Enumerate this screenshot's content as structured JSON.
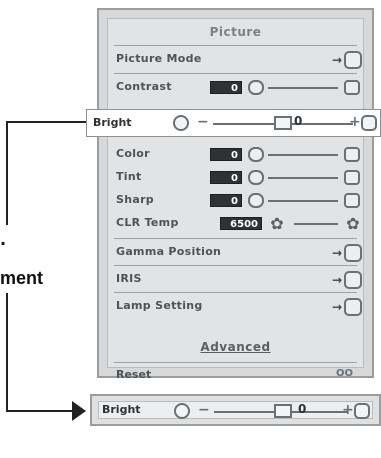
{
  "menu": {
    "title": "Picture",
    "rows": {
      "picture_mode": {
        "label": "Picture Mode",
        "action": "→"
      },
      "contrast": {
        "label": "Contrast",
        "value": "0"
      },
      "color": {
        "label": "Color",
        "value": "0"
      },
      "tint": {
        "label": "Tint",
        "value": "0"
      },
      "sharp": {
        "label": "Sharp",
        "value": "0"
      },
      "clr_temp": {
        "label": "CLR Temp",
        "value": "6500"
      },
      "gamma_position": {
        "label": "Gamma Position",
        "action": "→"
      },
      "iris": {
        "label": "IRIS",
        "action": "→"
      },
      "lamp_setting": {
        "label": "Lamp Setting",
        "action": "→"
      }
    },
    "advanced": "Advanced",
    "reset": {
      "label": "Reset",
      "icon_text": "OO"
    }
  },
  "bright_bar": {
    "label": "Bright",
    "minus": "−",
    "plus": "+",
    "value": "0"
  },
  "callout": {
    "text": "ment",
    "dot": "."
  },
  "icons": {
    "bar_icon": "round-icon",
    "reset_icon": "reset-icon",
    "gear_icon": "gear-icon",
    "chevron_icon": "arrow-right-icon"
  },
  "colors": {
    "menu_bg": "#d6d8d9",
    "menu_inner": "#e2e3e4",
    "value_box": "#2e3135",
    "text": "#4e5358"
  }
}
